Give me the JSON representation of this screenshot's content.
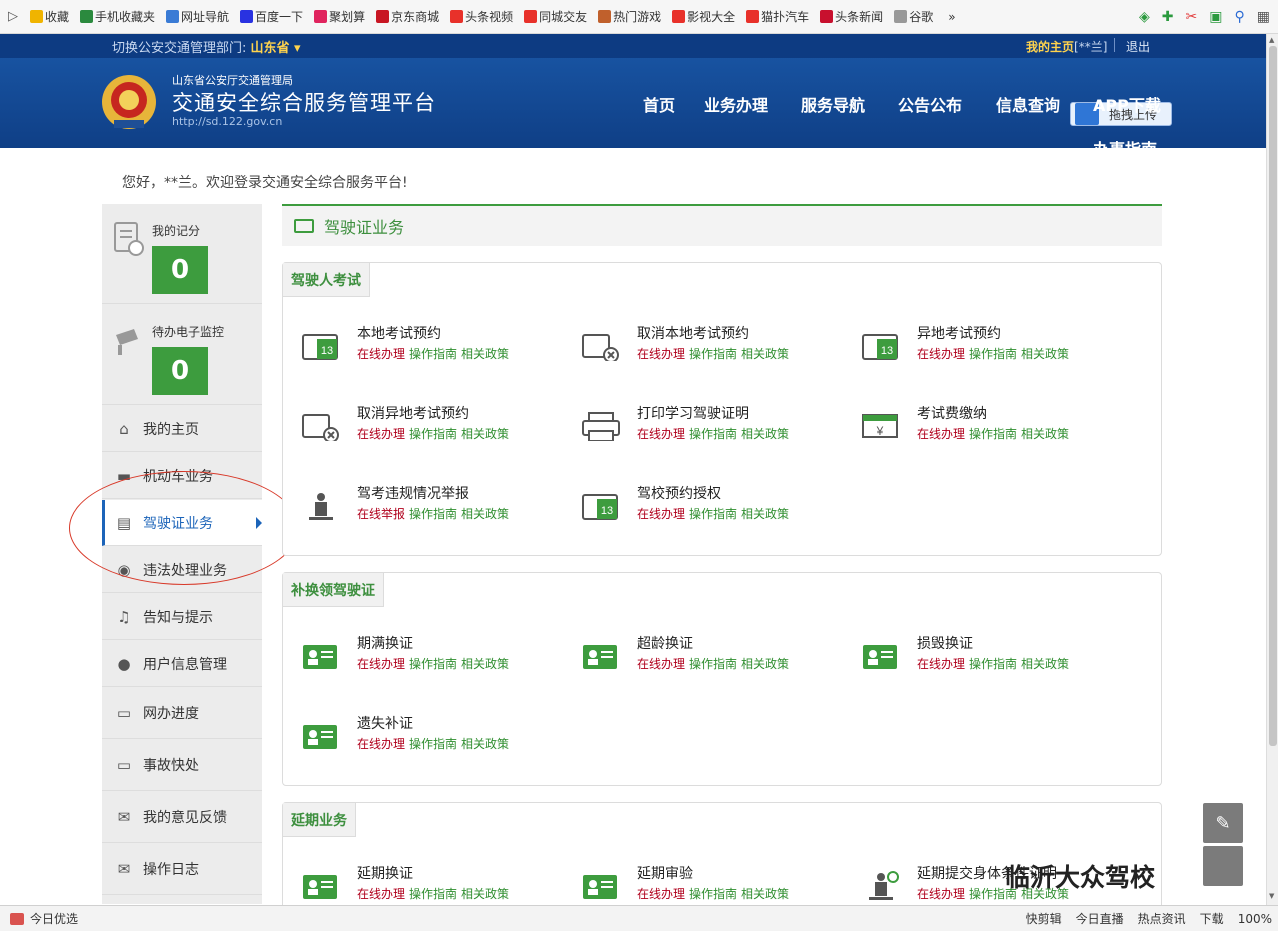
{
  "favbar": {
    "items": [
      {
        "label": "收藏",
        "icon": "star-icon",
        "color": "#f0b400"
      },
      {
        "label": "手机收藏夹",
        "icon": "phone-icon",
        "color": "#2b8a3e"
      },
      {
        "label": "网址导航",
        "icon": "globe-icon",
        "color": "#3a7bd5"
      },
      {
        "label": "百度一下",
        "icon": "baidu-icon",
        "color": "#2932e1"
      },
      {
        "label": "聚划算",
        "icon": "juhuasuan-icon",
        "color": "#e0245e"
      },
      {
        "label": "京东商城",
        "icon": "jd-icon",
        "color": "#c81623"
      },
      {
        "label": "头条视频",
        "icon": "play-icon",
        "color": "#e8312a"
      },
      {
        "label": "同城交友",
        "icon": "heart-icon",
        "color": "#e8312a"
      },
      {
        "label": "热门游戏",
        "icon": "game-icon",
        "color": "#c0602c"
      },
      {
        "label": "影视大全",
        "icon": "play-icon",
        "color": "#e8312a"
      },
      {
        "label": "猫扑汽车",
        "icon": "car-icon",
        "color": "#e8312a"
      },
      {
        "label": "头条新闻",
        "icon": "news-icon",
        "color": "#c8102e"
      },
      {
        "label": "谷歌",
        "icon": "page-icon",
        "color": "#999999"
      }
    ],
    "more": "»"
  },
  "header": {
    "dept_prefix": "切换公安交通管理部门:",
    "dept": "山东省 ▾",
    "my_home": "我的主页",
    "user_mask": "[**兰]",
    "logout": "退出",
    "org": "山东省公安厅交通管理局",
    "platform": "交通安全综合服务管理平台",
    "url": "http://sd.122.gov.cn",
    "upload": "拖拽上传",
    "nav": [
      "首页",
      "业务办理",
      "服务导航",
      "公告公布",
      "信息查询",
      "APP下载",
      "办事指南"
    ]
  },
  "greeting": "您好，**兰。欢迎登录交通安全综合服务平台!",
  "sidebar": {
    "score_label": "我的记分",
    "score_value": "0",
    "monitor_label": "待办电子监控",
    "monitor_value": "0",
    "items": [
      {
        "label": "我的主页",
        "icon": "home-icon",
        "glyph": "⌂"
      },
      {
        "label": "机动车业务",
        "icon": "truck-icon",
        "glyph": "▬"
      },
      {
        "label": "驾驶证业务",
        "icon": "license-icon",
        "glyph": "▤"
      },
      {
        "label": "违法处理业务",
        "icon": "camera-icon",
        "glyph": "◉"
      },
      {
        "label": "告知与提示",
        "icon": "bell-icon",
        "glyph": "♫"
      },
      {
        "label": "用户信息管理",
        "icon": "user-icon",
        "glyph": "●"
      },
      {
        "label": "网办进度",
        "icon": "progress-icon",
        "glyph": "▭"
      },
      {
        "label": "事故快处",
        "icon": "accident-icon",
        "glyph": "▭"
      },
      {
        "label": "我的意见反馈",
        "icon": "feedback-icon",
        "glyph": "✉"
      },
      {
        "label": "操作日志",
        "icon": "log-icon",
        "glyph": "✉"
      }
    ]
  },
  "content": {
    "title": "驾驶证业务",
    "link_labels": {
      "online": "在线办理",
      "report": "在线举报",
      "guide": "操作指南",
      "policy": "相关政策"
    },
    "sections": [
      {
        "tag": "驾驶人考试",
        "services": [
          {
            "name": "本地考试预约",
            "icon": "calendar-13-icon",
            "first": "online"
          },
          {
            "name": "取消本地考试预约",
            "icon": "calendar-cancel-icon",
            "first": "online"
          },
          {
            "name": "异地考试预约",
            "icon": "calendar-remote-icon",
            "first": "online"
          },
          {
            "name": "取消异地考试预约",
            "icon": "calendar-cancel-icon",
            "first": "online"
          },
          {
            "name": "打印学习驾驶证明",
            "icon": "printer-icon",
            "first": "online"
          },
          {
            "name": "考试费缴纳",
            "icon": "yuan-icon",
            "first": "online"
          },
          {
            "name": "驾考违规情况举报",
            "icon": "report-person-icon",
            "first": "report"
          },
          {
            "name": "驾校预约授权",
            "icon": "calendar-13-icon",
            "first": "online"
          }
        ]
      },
      {
        "tag": "补换领驾驶证",
        "services": [
          {
            "name": "期满换证",
            "icon": "card-person-icon",
            "first": "online"
          },
          {
            "name": "超龄换证",
            "icon": "card-age-icon",
            "first": "online"
          },
          {
            "name": "损毁换证",
            "icon": "card-damaged-icon",
            "first": "online"
          },
          {
            "name": "遗失补证",
            "icon": "card-lost-icon",
            "first": "online"
          }
        ]
      },
      {
        "tag": "延期业务",
        "services": [
          {
            "name": "延期换证",
            "icon": "card-clock-icon",
            "first": "online"
          },
          {
            "name": "延期审验",
            "icon": "card-check-icon",
            "first": "online"
          },
          {
            "name": "延期提交身体条件证明",
            "icon": "person-clock-icon",
            "first": "online"
          }
        ]
      }
    ]
  },
  "watermark": "临沂大众驾校",
  "statusbar": {
    "left": "今日优选",
    "items": [
      "快剪辑",
      "今日直播",
      "热点资讯",
      "下载",
      "100%"
    ]
  },
  "colors": {
    "brand_blue": "#0f3f86",
    "accent_green": "#3d9c3e",
    "red_link": "#b0001c"
  }
}
